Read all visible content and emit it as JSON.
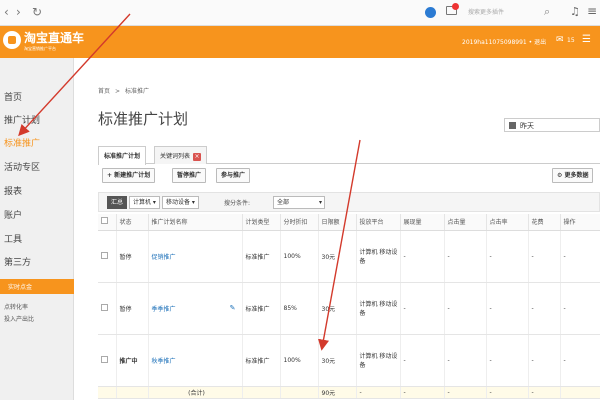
{
  "browser": {
    "search_placeholder": "搜索更多插件"
  },
  "header": {
    "logo": "淘宝直通车",
    "logo_sub": "淘宝营销推广平台",
    "user": "2019ha11075098991 • 退出",
    "mail_count": "15"
  },
  "sidebar": {
    "items": [
      {
        "label": "首页"
      },
      {
        "label": "推广计划"
      },
      {
        "label": "标准推广"
      },
      {
        "label": "活动专区"
      },
      {
        "label": "报表"
      },
      {
        "label": "账户"
      },
      {
        "label": "工具"
      },
      {
        "label": "第三方"
      }
    ],
    "section": "实时点金",
    "sub_items": [
      {
        "label": "点转化率"
      },
      {
        "label": "投入产出比"
      }
    ]
  },
  "breadcrumb": {
    "home": "首页",
    "sep": ">",
    "current": "标准推广"
  },
  "page_title": "标准推广计划",
  "date_select": "昨天",
  "tabs": [
    {
      "label": "标准推广计划"
    },
    {
      "label": "关键词列表"
    }
  ],
  "toolbar": {
    "new_plan": "+ 新建推广计划",
    "pause": "暂停推广",
    "join": "参与推广",
    "more_data": "更多数据"
  },
  "filter": {
    "summary": "汇总",
    "computer": "计算机",
    "mobile": "移动设备",
    "condition_label": "搜分条件:",
    "condition_value": "全部"
  },
  "table": {
    "headers": [
      "",
      "状态",
      "推广计划名称",
      "计划类型",
      "分时折扣",
      "日限额",
      "投放平台",
      "展现量",
      "点击量",
      "点击率",
      "花费",
      "操作"
    ],
    "rows": [
      {
        "status": "暂停",
        "name": "促销推广",
        "type": "标准推广",
        "discount": "100%",
        "limit": "30元",
        "platform": "计算机 移动设备",
        "impressions": "-",
        "clicks": "-",
        "ctr": "-",
        "cost": "-",
        "op": "-"
      },
      {
        "status": "暂停",
        "name": "季季推广",
        "type": "标准推广",
        "discount": "85%",
        "limit": "30元",
        "platform": "计算机 移动设备",
        "impressions": "-",
        "clicks": "-",
        "ctr": "-",
        "cost": "-",
        "op": "-"
      },
      {
        "status": "推广中",
        "name": "秋季推广",
        "type": "标准推广",
        "discount": "100%",
        "limit": "30元",
        "platform": "计算机 移动设备",
        "impressions": "-",
        "clicks": "-",
        "ctr": "-",
        "cost": "-",
        "op": "-"
      }
    ],
    "total": {
      "label": "(合计)",
      "limit": "90元",
      "platform": "-",
      "impressions": "-",
      "clicks": "-",
      "ctr": "-",
      "cost": "-"
    }
  },
  "colors": {
    "brand_orange": "#f7941d",
    "annotation_red": "#d33a2c"
  }
}
